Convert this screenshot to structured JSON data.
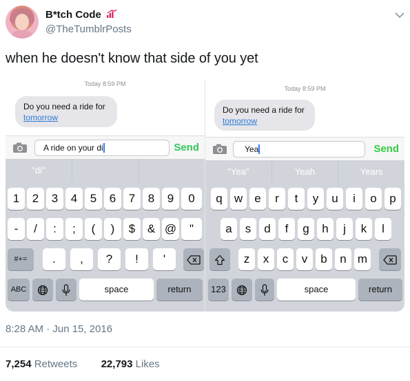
{
  "header": {
    "display_name": "B*tch Code",
    "handle": "@TheTumblrPosts"
  },
  "tweet": {
    "text": "when he doesn't know that side of you yet",
    "timestamp": "8:28 AM · Jun 15, 2016",
    "retweets_count": "7,254",
    "retweets_label": "Retweets",
    "likes_count": "22,793",
    "likes_label": "Likes"
  },
  "left_screen": {
    "timestamp": "Today 8:59 PM",
    "bubble_text": "Do you need a ride for",
    "bubble_link": "tomorrow",
    "input_text": "A ride on your di",
    "send_label": "Send",
    "suggestions": [
      "\"di\"",
      "",
      ""
    ],
    "row1": [
      "1",
      "2",
      "3",
      "4",
      "5",
      "6",
      "7",
      "8",
      "9",
      "0"
    ],
    "row2": [
      "-",
      "/",
      ":",
      ";",
      "(",
      ")",
      "$",
      "&",
      "@",
      "\""
    ],
    "row3_mode": "#+=",
    "row3": [
      ".",
      ",",
      "?",
      "!",
      "'"
    ],
    "row4": {
      "abc": "ABC",
      "space": "space",
      "return": "return"
    }
  },
  "right_screen": {
    "timestamp": "Today 8:59 PM",
    "bubble_text": "Do you need a ride for",
    "bubble_link": "tomorrow",
    "input_text": "Yea",
    "send_label": "Send",
    "suggestions": [
      "\"Yea\"",
      "Yeah",
      "Years"
    ],
    "row1": [
      "q",
      "w",
      "e",
      "r",
      "t",
      "y",
      "u",
      "i",
      "o",
      "p"
    ],
    "row2": [
      "a",
      "s",
      "d",
      "f",
      "g",
      "h",
      "j",
      "k",
      "l"
    ],
    "row3": [
      "z",
      "x",
      "c",
      "v",
      "b",
      "n",
      "m"
    ],
    "row4": {
      "num": "123",
      "space": "space",
      "return": "return"
    }
  },
  "icons": {
    "verified_like": "chart-bars-icon",
    "menu": "chevron-down-icon",
    "camera": "camera-icon",
    "globe": "globe-icon",
    "mic": "microphone-icon",
    "delete": "backspace-icon",
    "shift": "shift-icon"
  },
  "colors": {
    "send_green": "#34c759",
    "link_blue": "#2f7bd6",
    "twitter_gray": "#657786"
  }
}
